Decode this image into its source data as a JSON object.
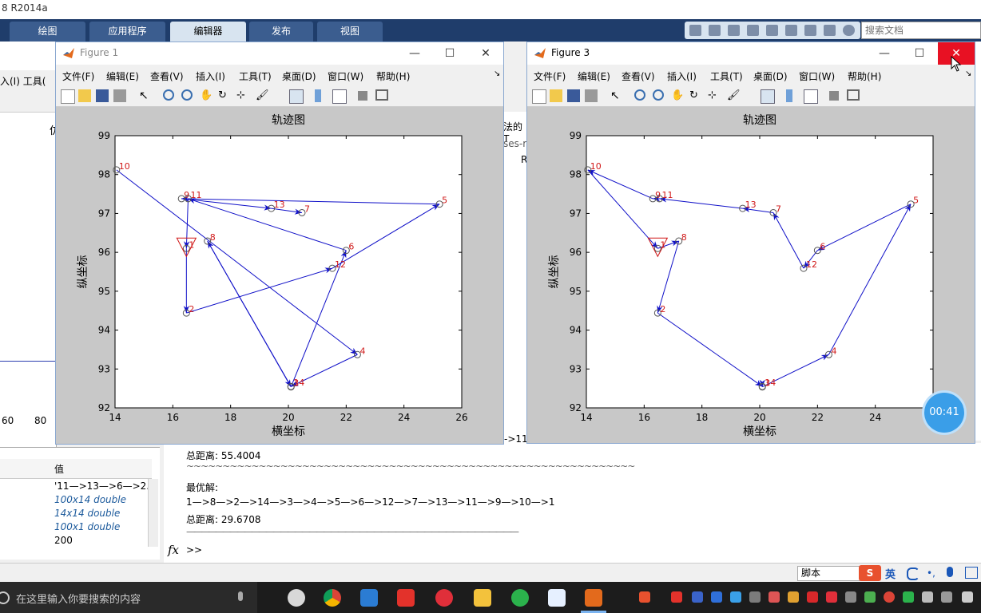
{
  "app": {
    "title": "8 R2014a"
  },
  "ribbon": {
    "tabs": [
      {
        "label": "绘图"
      },
      {
        "label": "应用程序"
      },
      {
        "label": "编辑器"
      },
      {
        "label": "发布"
      },
      {
        "label": "视图"
      }
    ],
    "search_placeholder": "搜索文档"
  },
  "background": {
    "menu_fragment": "入(I)  工具(",
    "right_fragments": [
      "法的T",
      "ses-r",
      "R"
    ],
    "axis_ticks": [
      "60",
      "80"
    ],
    "cmd_fragment": "->11",
    "plot_title_fragment": "仿"
  },
  "workspace": {
    "header": "值",
    "rows": [
      "'11—>13—>6—>2.",
      "100x14 double",
      "14x14 double",
      "100x1 double",
      "200"
    ]
  },
  "command_window": {
    "lines": [
      "总距离: 55.4004",
      "~~~~~~~~~~~~~~~~~~~~~~~~~~~~~~~~~~~~~~~~~~~~~~~~~~~~~~~~~~~~~~",
      "最优解:",
      "1—>8—>2—>14—>3—>4—>5—>6—>12—>7—>13—>11—>9—>10—>1",
      "总距离: 29.6708",
      "——————————————————————————————————————————————"
    ],
    "prompt": ">>",
    "fx": "fx"
  },
  "status": {
    "script_label": "脚本"
  },
  "taskbar": {
    "search_placeholder": "在这里输入你要搜索的内容"
  },
  "tray": {
    "ime": "英"
  },
  "timer": {
    "label": "00:41"
  },
  "figures": [
    {
      "title": "Figure 1",
      "menu": [
        "文件(F)",
        "编辑(E)",
        "查看(V)",
        "插入(I)",
        "工具(T)",
        "桌面(D)",
        "窗口(W)",
        "帮助(H)"
      ],
      "chart": {
        "title": "轨迹图",
        "xlabel": "横坐标",
        "ylabel": "纵坐标",
        "xlim": [
          14,
          26
        ],
        "ylim": [
          92,
          99
        ],
        "xticks": [
          14,
          16,
          18,
          20,
          22,
          24,
          26
        ],
        "yticks": [
          92,
          93,
          94,
          95,
          96,
          97,
          98,
          99
        ],
        "route": [
          10,
          4,
          14,
          8,
          3,
          6,
          11,
          1,
          2,
          12,
          5,
          9,
          13,
          7
        ]
      }
    },
    {
      "title": "Figure 3",
      "menu": [
        "文件(F)",
        "编辑(E)",
        "查看(V)",
        "插入(I)",
        "工具(T)",
        "桌面(D)",
        "窗口(W)",
        "帮助(H)"
      ],
      "chart": {
        "title": "轨迹图",
        "xlabel": "横坐标",
        "ylabel": "纵坐标",
        "xlim": [
          14,
          26
        ],
        "ylim": [
          92,
          99
        ],
        "xticks": [
          14,
          16,
          18,
          20,
          22,
          24
        ],
        "yticks": [
          92,
          93,
          94,
          95,
          96,
          97,
          98,
          99
        ],
        "route": [
          1,
          8,
          2,
          14,
          3,
          4,
          5,
          6,
          12,
          7,
          13,
          11,
          9,
          10,
          1
        ]
      }
    }
  ],
  "chart_data": {
    "type": "scatter",
    "title": "轨迹图",
    "xlabel": "横坐标",
    "ylabel": "纵坐标",
    "xlim": [
      14,
      26
    ],
    "ylim": [
      92,
      99
    ],
    "cities": [
      {
        "id": 1,
        "x": 16.47,
        "y": 96.1
      },
      {
        "id": 2,
        "x": 16.47,
        "y": 94.44
      },
      {
        "id": 3,
        "x": 20.09,
        "y": 92.54
      },
      {
        "id": 4,
        "x": 22.39,
        "y": 93.37
      },
      {
        "id": 5,
        "x": 25.23,
        "y": 97.24
      },
      {
        "id": 6,
        "x": 22.0,
        "y": 96.05
      },
      {
        "id": 7,
        "x": 20.47,
        "y": 97.02
      },
      {
        "id": 8,
        "x": 17.2,
        "y": 96.29
      },
      {
        "id": 9,
        "x": 16.3,
        "y": 97.38
      },
      {
        "id": 10,
        "x": 14.05,
        "y": 98.12
      },
      {
        "id": 11,
        "x": 16.53,
        "y": 97.38
      },
      {
        "id": 12,
        "x": 21.52,
        "y": 95.59
      },
      {
        "id": 13,
        "x": 19.41,
        "y": 97.13
      },
      {
        "id": 14,
        "x": 20.09,
        "y": 92.55
      }
    ],
    "start_city": 1
  }
}
